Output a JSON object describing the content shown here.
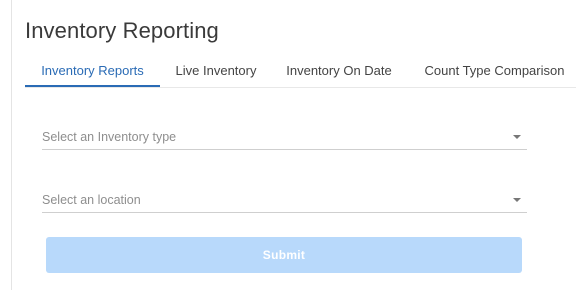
{
  "page": {
    "title": "Inventory Reporting"
  },
  "tabs": [
    {
      "label": "Inventory Reports",
      "active": true
    },
    {
      "label": "Live Inventory",
      "active": false
    },
    {
      "label": "Inventory On Date",
      "active": false
    },
    {
      "label": "Count Type Comparison",
      "active": false
    }
  ],
  "form": {
    "inventory_type": {
      "placeholder": "Select an Inventory type",
      "icon": "chevron-down-icon"
    },
    "location": {
      "placeholder": "Select an location",
      "icon": "chevron-down-icon"
    },
    "submit_label": "Submit"
  },
  "colors": {
    "accent": "#2a6bb5",
    "submit_disabled_bg": "#b8d9fb"
  }
}
